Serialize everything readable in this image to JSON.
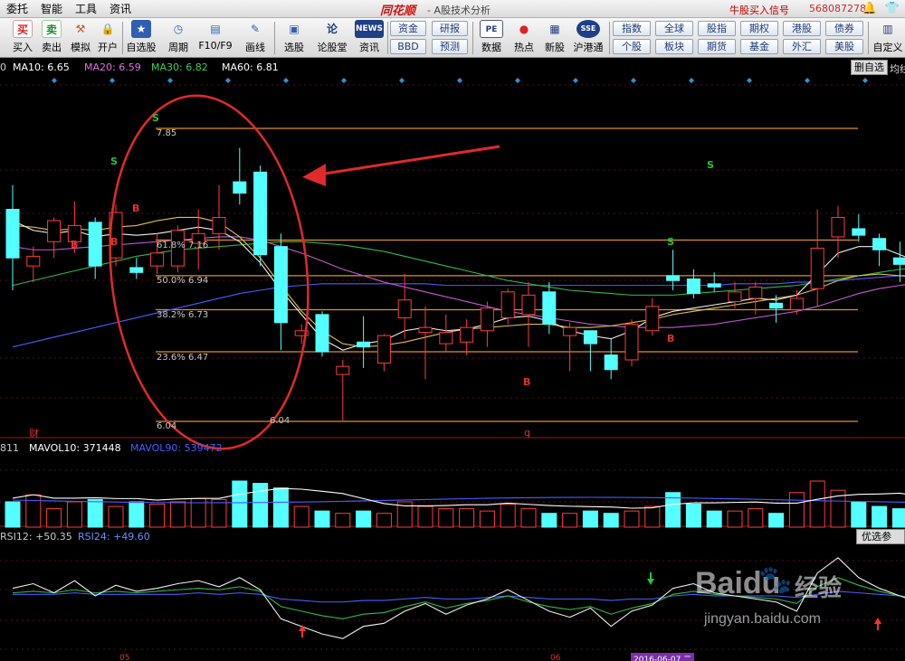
{
  "menu": {
    "items": [
      "委托",
      "智能",
      "工具",
      "资讯"
    ],
    "brand": "同花顺",
    "subtitle": "- A股技术分析",
    "signal": "牛股买入信号",
    "account": "568087278"
  },
  "toolbar": {
    "buttons": [
      {
        "label": "买入",
        "glyph": "买"
      },
      {
        "label": "卖出",
        "glyph": "卖"
      },
      {
        "label": "模拟",
        "glyph": "⚒"
      },
      {
        "label": "开户",
        "glyph": "🔒"
      },
      {
        "label": "自选股",
        "glyph": "★"
      },
      {
        "label": "周期",
        "glyph": "◷"
      },
      {
        "label": "F10/F9",
        "glyph": "▤"
      },
      {
        "label": "画线",
        "glyph": "✎"
      },
      {
        "label": "选股",
        "glyph": "▣"
      },
      {
        "label": "论股堂",
        "glyph": "论"
      },
      {
        "label": "资讯",
        "glyph": "NEWS"
      },
      {
        "label": "数据",
        "glyph": "PE"
      },
      {
        "label": "热点",
        "glyph": "●"
      },
      {
        "label": "新股",
        "glyph": "▦"
      },
      {
        "label": "沪港通",
        "glyph": "SSE"
      },
      {
        "label": "自定义",
        "glyph": "▥"
      }
    ],
    "grid1": [
      "资金",
      "研报",
      "BBD",
      "预测"
    ],
    "grid2": [
      "指数",
      "全球",
      "股指",
      "期权",
      "港股",
      "债券",
      "个股",
      "板块",
      "期货",
      "基金",
      "外汇",
      "美股"
    ]
  },
  "indicators": {
    "ma_prefix": "0",
    "ma10": "MA10: 6.65",
    "ma20": "MA20: 6.59",
    "ma30": "MA30: 6.82",
    "ma60": "MA60: 6.81",
    "right_labels": [
      "删自选",
      "均线"
    ],
    "vol_prefix": "811",
    "mavol10": "MAVOL10: 371448",
    "mavol90": "MAVOL90: 539472",
    "rsi12": "RSI12: +50.35",
    "rsi24": "RSI24: +49.60",
    "rsi_button": "优选参数"
  },
  "fib": [
    {
      "label": "7.85",
      "price": 7.85
    },
    {
      "label": "61.8%  7.16",
      "price": 7.16
    },
    {
      "label": "50.0%  6.94",
      "price": 6.94
    },
    {
      "label": "38.2%  6.73",
      "price": 6.73
    },
    {
      "label": "23.6%  6.47",
      "price": 6.47
    },
    {
      "label": "6.04",
      "price": 6.04
    }
  ],
  "low_label": "6.04",
  "signals": [
    "S",
    "S",
    "S",
    "B",
    "B",
    "B",
    "B",
    "B"
  ],
  "markers": {
    "cai": "财",
    "q": "q"
  },
  "xaxis": [
    "05",
    "06",
    "2016-06-07 二"
  ],
  "watermark": {
    "brand": "Baidu",
    "brand_cn": "经验",
    "url": "jingyan.baidu.com"
  },
  "chart_data": {
    "type": "candlestick",
    "ylim": [
      5.95,
      8.0
    ],
    "candles": [
      [
        7.35,
        7.5,
        6.85,
        7.05
      ],
      [
        7.0,
        7.12,
        6.9,
        7.06
      ],
      [
        7.15,
        7.3,
        7.05,
        7.28
      ],
      [
        7.15,
        7.4,
        7.08,
        7.25
      ],
      [
        7.27,
        7.3,
        6.92,
        7.0
      ],
      [
        7.05,
        7.38,
        7.0,
        7.33
      ],
      [
        6.99,
        7.05,
        6.92,
        6.96
      ],
      [
        7.0,
        7.2,
        6.95,
        7.08
      ],
      [
        7.0,
        7.25,
        6.96,
        7.22
      ],
      [
        7.14,
        7.35,
        6.98,
        7.2
      ],
      [
        7.2,
        7.5,
        7.1,
        7.3
      ],
      [
        7.52,
        7.73,
        7.38,
        7.45
      ],
      [
        7.58,
        7.62,
        7.0,
        7.07
      ],
      [
        7.12,
        7.2,
        6.48,
        6.65
      ],
      [
        6.57,
        6.64,
        6.52,
        6.6
      ],
      [
        6.7,
        6.72,
        6.44,
        6.47
      ],
      [
        6.33,
        6.42,
        6.04,
        6.38
      ],
      [
        6.53,
        6.69,
        6.37,
        6.5
      ],
      [
        6.4,
        6.58,
        6.35,
        6.57
      ],
      [
        6.68,
        6.95,
        6.55,
        6.79
      ],
      [
        6.59,
        6.75,
        6.3,
        6.62
      ],
      [
        6.52,
        6.7,
        6.47,
        6.59
      ],
      [
        6.53,
        6.67,
        6.45,
        6.62
      ],
      [
        6.6,
        6.78,
        6.5,
        6.74
      ],
      [
        6.68,
        6.86,
        6.64,
        6.84
      ],
      [
        6.7,
        6.9,
        6.5,
        6.82
      ],
      [
        6.84,
        6.9,
        6.58,
        6.64
      ],
      [
        6.57,
        6.65,
        6.35,
        6.62
      ],
      [
        6.6,
        6.6,
        6.35,
        6.52
      ],
      [
        6.45,
        6.55,
        6.3,
        6.36
      ],
      [
        6.42,
        6.67,
        6.38,
        6.64
      ],
      [
        6.6,
        6.8,
        6.57,
        6.75
      ],
      [
        6.94,
        7.1,
        6.85,
        6.91
      ],
      [
        6.92,
        6.98,
        6.8,
        6.83
      ],
      [
        6.89,
        6.96,
        6.84,
        6.87
      ],
      [
        6.78,
        6.9,
        6.74,
        6.84
      ],
      [
        6.8,
        6.9,
        6.7,
        6.87
      ],
      [
        6.77,
        6.82,
        6.65,
        6.74
      ],
      [
        6.73,
        6.85,
        6.7,
        6.8
      ],
      [
        6.86,
        7.35,
        6.75,
        7.11
      ],
      [
        7.18,
        7.37,
        7.05,
        7.3
      ],
      [
        7.23,
        7.32,
        7.15,
        7.19
      ],
      [
        7.17,
        7.2,
        7.0,
        7.1
      ],
      [
        7.05,
        7.15,
        6.9,
        7.01
      ],
      [
        7.03,
        7.1,
        6.9,
        6.91
      ],
      [
        6.99,
        7.03,
        6.94,
        7.0
      ],
      [
        6.95,
        7.05,
        6.9,
        6.94
      ],
      [
        6.9,
        6.93,
        6.55,
        6.76
      ],
      [
        6.75,
        6.88,
        6.68,
        6.72
      ],
      [
        6.86,
        6.95,
        6.8,
        6.88
      ]
    ],
    "volumes": [
      0.55,
      0.7,
      0.4,
      0.55,
      0.6,
      0.45,
      0.55,
      0.5,
      0.55,
      0.62,
      0.6,
      1.0,
      0.95,
      0.85,
      0.45,
      0.35,
      0.3,
      0.35,
      0.3,
      0.55,
      0.45,
      0.4,
      0.4,
      0.35,
      0.5,
      0.4,
      0.3,
      0.3,
      0.35,
      0.3,
      0.35,
      0.45,
      0.75,
      0.5,
      0.35,
      0.35,
      0.4,
      0.3,
      0.75,
      1.0,
      0.8,
      0.55,
      0.45,
      0.4,
      0.35,
      0.35,
      0.35,
      0.35,
      0.25,
      0.25
    ],
    "ma_white": [
      7.28,
      7.22,
      7.2,
      7.22,
      7.18,
      7.2,
      7.19,
      7.2,
      7.22,
      7.24,
      7.22,
      7.15,
      7.02,
      6.85,
      6.7,
      6.55,
      6.48,
      6.52,
      6.54,
      6.6,
      6.62,
      6.6,
      6.61,
      6.64,
      6.68,
      6.69,
      6.66,
      6.6,
      6.57,
      6.55,
      6.6,
      6.68,
      6.72,
      6.74,
      6.76,
      6.78,
      6.8,
      6.79,
      6.82,
      6.95,
      7.08,
      7.12,
      7.12,
      7.07,
      7.02,
      6.99,
      6.96,
      6.9,
      6.86,
      6.85
    ],
    "ma_yellow": [
      7.25,
      7.24,
      7.22,
      7.23,
      7.22,
      7.24,
      7.25,
      7.28,
      7.3,
      7.3,
      7.27,
      7.18,
      7.05,
      6.88,
      6.72,
      6.6,
      6.52,
      6.5,
      6.51,
      6.53,
      6.56,
      6.59,
      6.61,
      6.62,
      6.63,
      6.64,
      6.64,
      6.62,
      6.62,
      6.63,
      6.65,
      6.67,
      6.7,
      6.72,
      6.74,
      6.76,
      6.78,
      6.8,
      6.82,
      6.86,
      6.91,
      6.94,
      6.95,
      6.94,
      6.93,
      6.92,
      6.91,
      6.89,
      6.88,
      6.87
    ],
    "ma_magenta": [
      7.12,
      7.1,
      7.1,
      7.11,
      7.12,
      7.13,
      7.14,
      7.15,
      7.16,
      7.17,
      7.18,
      7.18,
      7.16,
      7.12,
      7.08,
      7.03,
      6.98,
      6.94,
      6.9,
      6.87,
      6.84,
      6.81,
      6.78,
      6.75,
      6.72,
      6.7,
      6.68,
      6.66,
      6.64,
      6.63,
      6.62,
      6.62,
      6.62,
      6.63,
      6.64,
      6.66,
      6.68,
      6.7,
      6.72,
      6.75,
      6.79,
      6.83,
      6.86,
      6.88,
      6.9,
      6.91,
      6.92,
      6.92,
      6.92,
      6.92
    ],
    "ma_green": [
      6.88,
      6.91,
      6.94,
      6.97,
      7.0,
      7.03,
      7.06,
      7.08,
      7.1,
      7.11,
      7.12,
      7.13,
      7.14,
      7.15,
      7.15,
      7.14,
      7.13,
      7.11,
      7.09,
      7.06,
      7.03,
      7.0,
      6.97,
      6.94,
      6.91,
      6.89,
      6.87,
      6.85,
      6.84,
      6.83,
      6.82,
      6.82,
      6.82,
      6.83,
      6.84,
      6.85,
      6.86,
      6.87,
      6.88,
      6.9,
      6.92,
      6.94,
      6.96,
      6.98,
      6.99,
      7.0,
      7.0,
      7.0,
      7.0,
      7.0
    ],
    "ma_blue": [
      6.5,
      6.53,
      6.56,
      6.59,
      6.62,
      6.65,
      6.68,
      6.71,
      6.74,
      6.77,
      6.8,
      6.83,
      6.85,
      6.87,
      6.88,
      6.89,
      6.89,
      6.89,
      6.89,
      6.89,
      6.89,
      6.88,
      6.88,
      6.88,
      6.88,
      6.88,
      6.88,
      6.88,
      6.88,
      6.88,
      6.88,
      6.88,
      6.88,
      6.88,
      6.88,
      6.89,
      6.89,
      6.89,
      6.9,
      6.9,
      6.91,
      6.92,
      6.93,
      6.94,
      6.95,
      6.96,
      6.97,
      6.97,
      6.98,
      6.98
    ],
    "rsi_white": [
      55,
      58,
      52,
      60,
      50,
      57,
      53,
      55,
      58,
      60,
      56,
      62,
      54,
      35,
      30,
      25,
      22,
      30,
      32,
      40,
      45,
      38,
      44,
      48,
      54,
      47,
      40,
      36,
      42,
      30,
      40,
      44,
      55,
      58,
      52,
      50,
      48,
      46,
      40,
      65,
      75,
      62,
      55,
      50,
      45,
      42,
      38,
      30,
      25,
      32
    ],
    "rsi_green": [
      52,
      53,
      52,
      54,
      52,
      53,
      52,
      53,
      54,
      55,
      54,
      56,
      53,
      43,
      40,
      37,
      35,
      38,
      39,
      43,
      46,
      42,
      45,
      47,
      50,
      46,
      43,
      41,
      43,
      38,
      42,
      45,
      51,
      53,
      51,
      50,
      49,
      48,
      45,
      56,
      62,
      57,
      53,
      50,
      47,
      45,
      43,
      38,
      35,
      37
    ],
    "rsi_blue": [
      51,
      51,
      51,
      52,
      51,
      51,
      51,
      51,
      51,
      52,
      51,
      52,
      51,
      48,
      47,
      46,
      46,
      47,
      47,
      48,
      49,
      48,
      48,
      49,
      50,
      49,
      48,
      48,
      48,
      47,
      48,
      48,
      50,
      51,
      50,
      50,
      50,
      50,
      49,
      51,
      53,
      52,
      51,
      50,
      49,
      49,
      48,
      47,
      47,
      47
    ]
  }
}
